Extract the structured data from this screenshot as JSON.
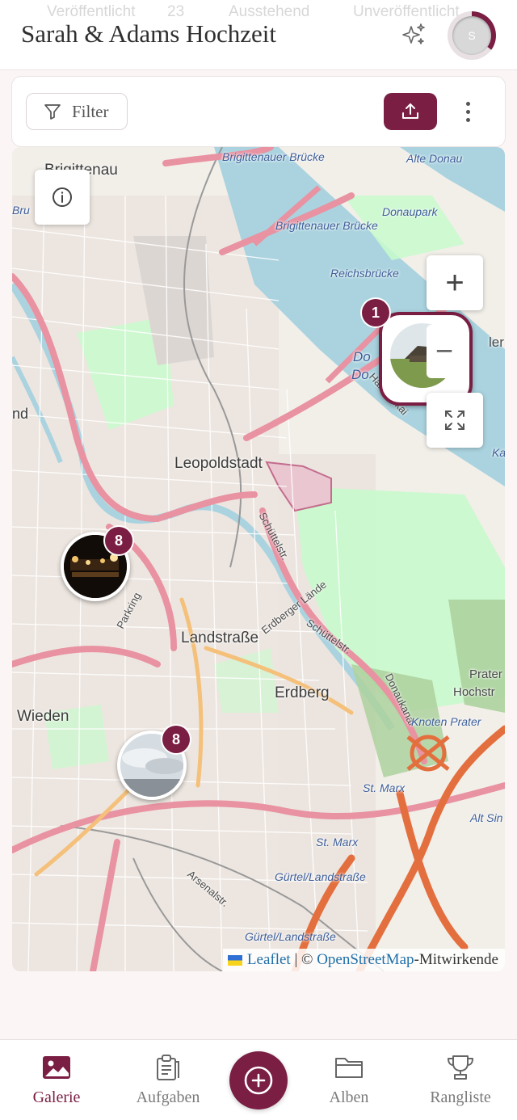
{
  "header": {
    "title": "Sarah & Adams Hochzeit",
    "avatar_initial": "S",
    "ghost_tabs": [
      "Veröffentlicht",
      "23",
      "Ausstehend",
      "Unveröffentlicht"
    ]
  },
  "toolbar": {
    "filter_label": "Filter"
  },
  "map": {
    "labels": {
      "brigittenau": "Brigittenau",
      "brigittenauer_bruecke_1": "Brigittenauer Brücke",
      "brigittenauer_bruecke_2": "Brigittenauer Brücke",
      "alte_donau": "Alte Donau",
      "donaupark": "Donaupark",
      "reichsbruecke": "Reichsbrücke",
      "leopoldstadt": "Leopoldstadt",
      "landstrasse": "Landstraße",
      "erdberg": "Erdberg",
      "wieden": "Wieden",
      "schuettelstr_1": "Schüttelstr.",
      "schuettelstr_2": "Schüttelstr.",
      "erdberger_laende": "Erdberger Lände",
      "parkring": "Parkring",
      "knoten_prater": "Knoten Prater",
      "st_marx_1": "St. Marx",
      "st_marx_2": "St. Marx",
      "guertel_1": "Gürtel/Landstraße",
      "guertel_2": "Gürtel/Landstraße",
      "arsenalstr": "Arsenalstr.",
      "prater": "Prater",
      "hochstr": "Hochstr",
      "alt_sin": "Alt Sin",
      "handelskai": "Handelskai",
      "donaukanal": "Donaukanal",
      "nd": "nd",
      "bru": "Bru",
      "ka": "Ka",
      "ler": "ler",
      "do_1": "Do",
      "do_2": "Do"
    },
    "clusters": [
      {
        "count": "1",
        "photo": "grass-hut"
      },
      {
        "count": "8",
        "photo": "night-lights"
      },
      {
        "count": "8",
        "photo": "cloudy-sky"
      }
    ],
    "zoom_in": "+",
    "zoom_out": "−",
    "attribution": {
      "leaflet": "Leaflet",
      "separator": " | © ",
      "osm": "OpenStreetMap",
      "suffix": "-Mitwirkende"
    }
  },
  "nav": {
    "items": [
      {
        "label": "Galerie",
        "icon": "image-icon"
      },
      {
        "label": "Aufgaben",
        "icon": "clipboard-icon"
      },
      {
        "label": "Alben",
        "icon": "folder-icon"
      },
      {
        "label": "Rangliste",
        "icon": "trophy-icon"
      }
    ]
  },
  "colors": {
    "accent": "#7a1e43",
    "water": "#aad3df",
    "park": "#c8facc",
    "road_major": "#e892a2"
  }
}
